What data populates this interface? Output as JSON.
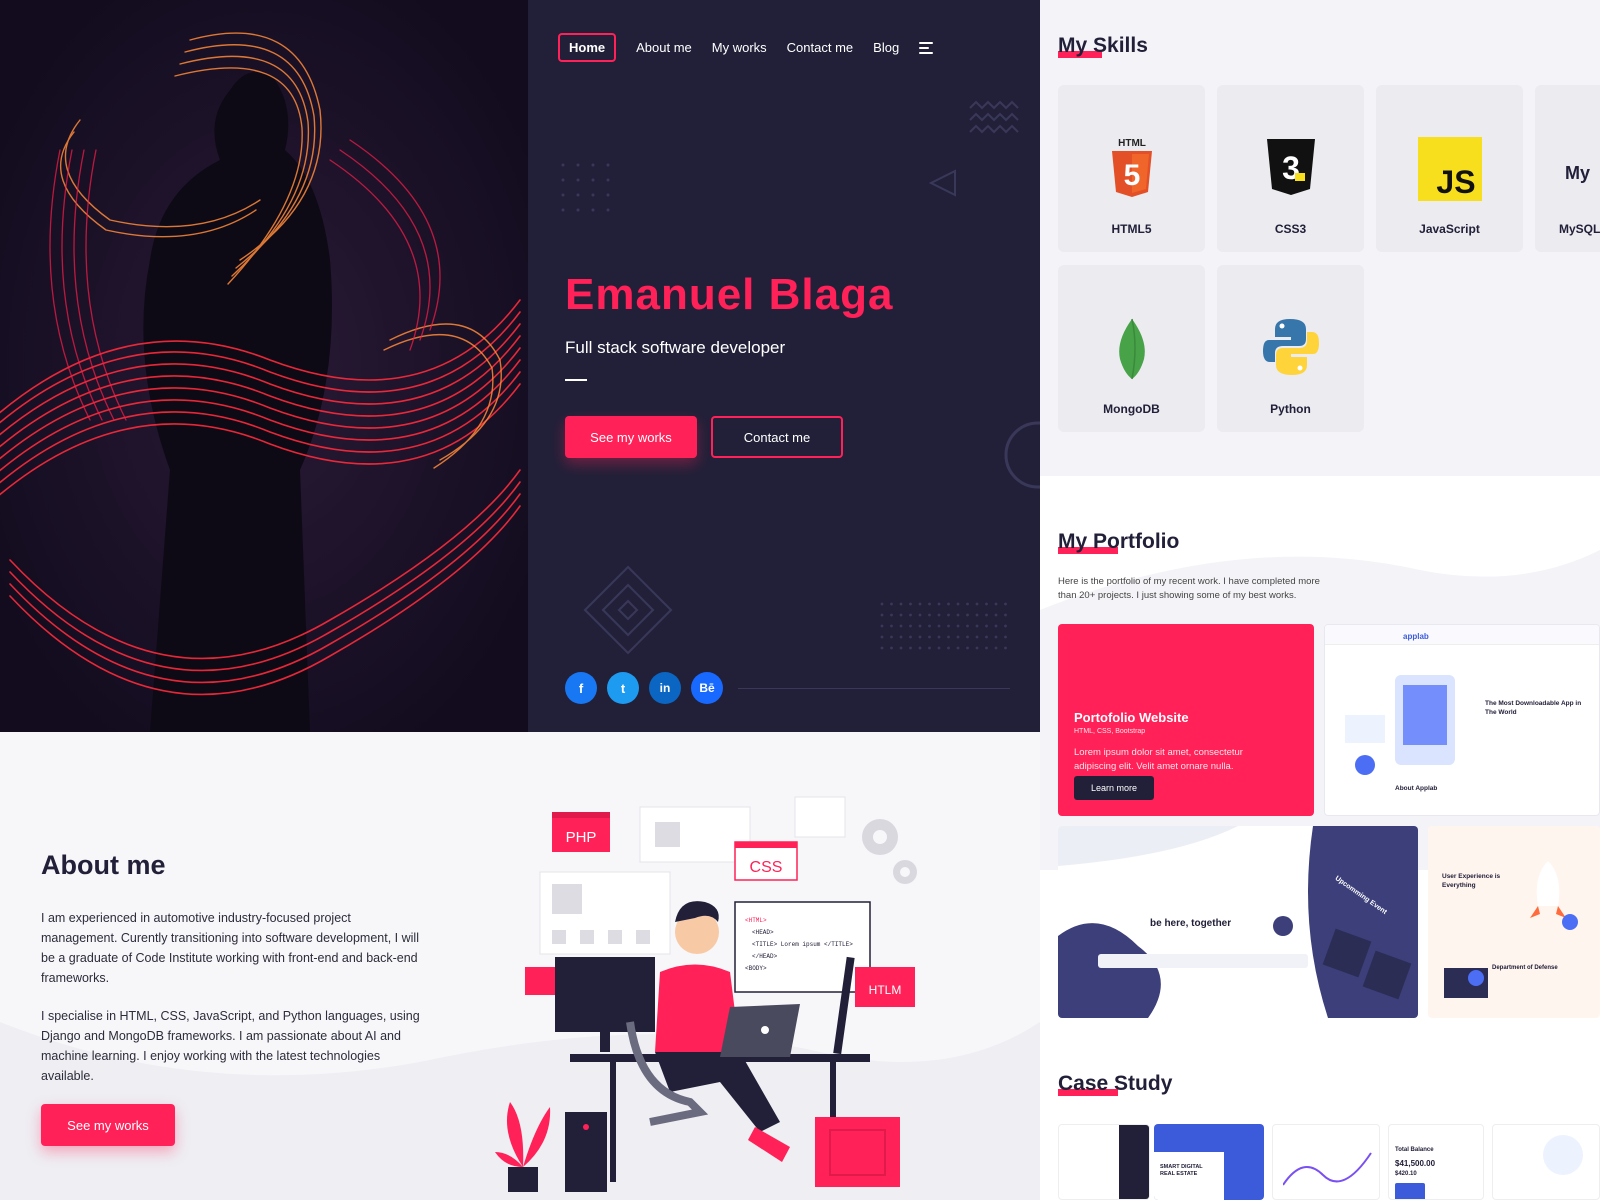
{
  "nav": {
    "items": [
      "Home",
      "About me",
      "My works",
      "Contact me",
      "Blog"
    ],
    "active_index": 0
  },
  "hero": {
    "name": "Emanuel Blaga",
    "subtitle": "Full stack software developer",
    "primary_button": "See my works",
    "secondary_button": "Contact me",
    "social": [
      {
        "icon": "facebook-icon",
        "label": "f",
        "color": "#1877f2"
      },
      {
        "icon": "twitter-icon",
        "label": "t",
        "color": "#1d9bf0"
      },
      {
        "icon": "linkedin-icon",
        "label": "in",
        "color": "#0a66c2"
      },
      {
        "icon": "behance-icon",
        "label": "Bē",
        "color": "#1769ff"
      }
    ]
  },
  "about": {
    "title_highlight": "About",
    "title_rest": " me",
    "paragraph_1": "I am experienced in automotive industry-focused project management. Curently transitioning into software development, I will be a graduate of Code Institute working with front-end and back-end frameworks.",
    "paragraph_2": "I specialise in HTML, CSS, JavaScript, and Python languages, using Django and MongoDB frameworks. I am passionate about AI and machine learning. I enjoy working with the latest technologies available.",
    "button": "See my works",
    "illustration_tags": [
      "PHP",
      "CSS",
      "HTLM"
    ],
    "code_lines": [
      "<HTML>",
      "<HEAD>",
      "<TITLE> Lorem ipsum </TITLE>",
      "</HEAD>",
      "<BODY>"
    ]
  },
  "skills": {
    "title": "My Skills",
    "items": [
      {
        "name": "HTML5",
        "icon": "html5-icon",
        "logo_text": "HTML"
      },
      {
        "name": "CSS3",
        "icon": "css3-icon",
        "logo_text": "3"
      },
      {
        "name": "JavaScript",
        "icon": "javascript-icon",
        "logo_text": "JS"
      },
      {
        "name": "MySQL",
        "icon": "mysql-icon",
        "logo_text": "My"
      },
      {
        "name": "MongoDB",
        "icon": "mongodb-icon",
        "logo_text": ""
      },
      {
        "name": "Python",
        "icon": "python-icon",
        "logo_text": ""
      }
    ]
  },
  "portfolio": {
    "title": "My Portfolio",
    "intro": "Here is the portfolio of my recent work. I have completed more than 20+ projects. I just showing some of my best works.",
    "featured": {
      "title": "Portofolio Website",
      "stack": "HTML, CSS, Bootstrap",
      "description": "Lorem ipsum dolor sit amet, consectetur adipiscing elit. Velit amet ornare nulla.",
      "button": "Learn more"
    },
    "thumb_texts": {
      "app_heading": "The Most Downloadable App in The World",
      "app_about": "About Applab",
      "app_brand": "applab",
      "community_heading": "be here, together",
      "event_text": "Upcomming Event",
      "agency_heading": "User Experience is Everything",
      "agency_sub": "Department of Defense"
    }
  },
  "case_study": {
    "title": "Case Study",
    "thumb_texts": {
      "realestate": "SMART DIGITAL REAL ESTATE",
      "balance_label": "Total Balance",
      "balance_value": "$41,500.00",
      "balance_sub": "$420.10"
    }
  },
  "colors": {
    "accent": "#ff2157",
    "dark": "#222039",
    "light_bg": "#f4f4f8"
  }
}
